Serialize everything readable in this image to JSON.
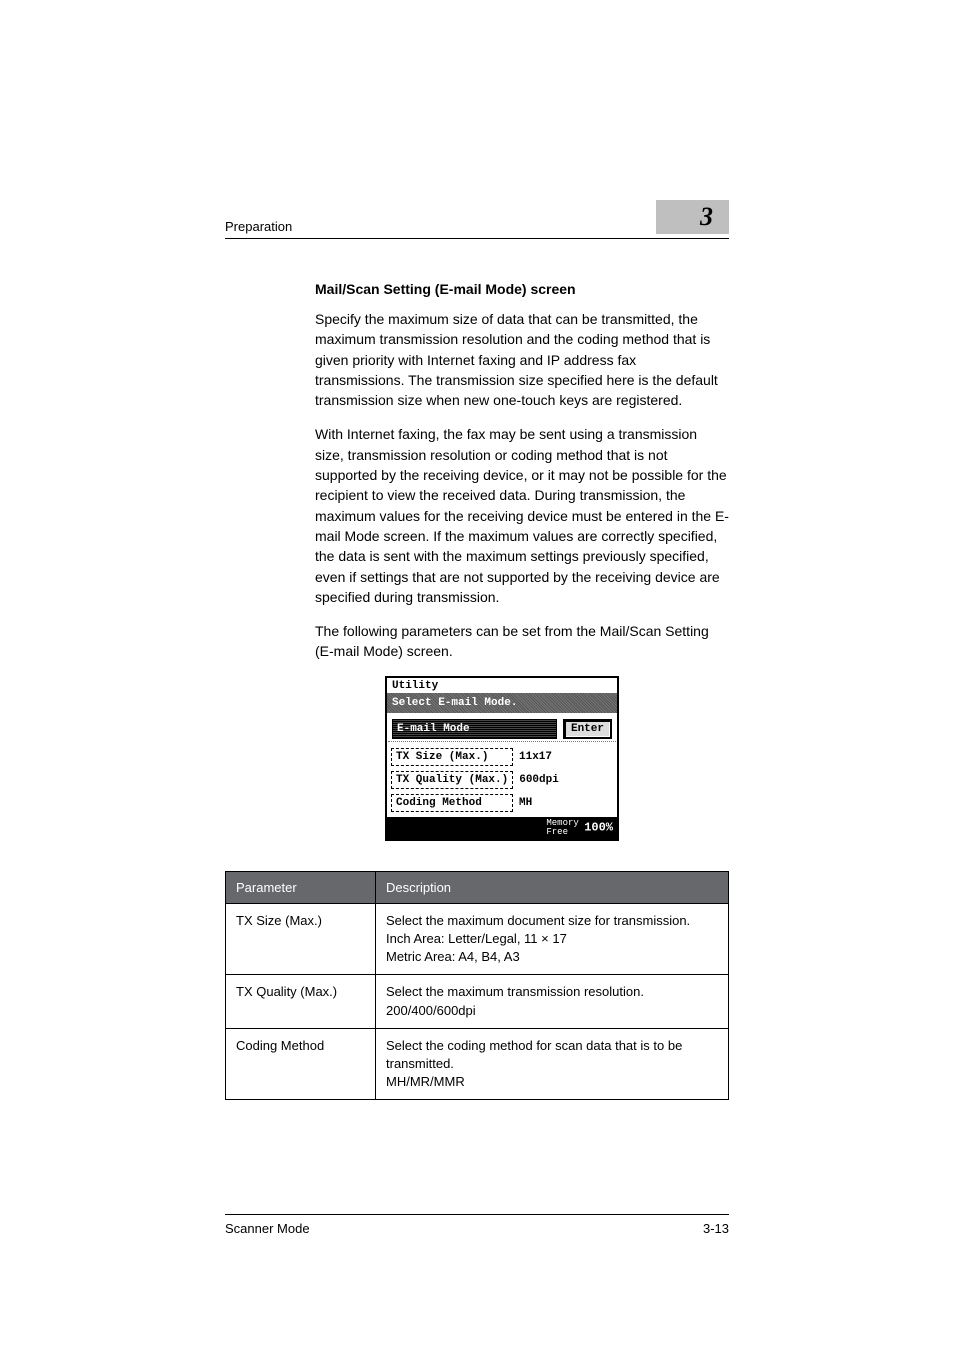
{
  "header": {
    "left": "Preparation",
    "chapter": "3"
  },
  "section_title": "Mail/Scan Setting (E-mail Mode) screen",
  "paragraphs": {
    "p1": "Specify the maximum size of data that can be transmitted, the maximum transmission resolution and the coding method that is given priority with Internet faxing and IP address fax transmissions. The transmission size specified here is the default transmission size when new one-touch keys are registered.",
    "p2": "With Internet faxing, the fax may be sent using a transmission size, transmission resolution or coding method that is not supported by the receiving device, or it may not be possible for the recipient to view the received data. During transmission, the maximum values for the receiving device must be entered in the E-mail Mode screen. If the maximum values are correctly specified, the data is sent with the maximum settings previously specified, even if settings that are not supported by the receiving device are specified during transmission.",
    "p3": "The following parameters can be set from the Mail/Scan Setting (E-mail Mode) screen."
  },
  "lcd": {
    "title": "Utility",
    "banner": "Select E-mail Mode.",
    "mode_label": "E-mail Mode",
    "enter": "Enter",
    "rows": [
      {
        "label": "TX Size (Max.)",
        "value": "11x17"
      },
      {
        "label": "TX Quality (Max.)",
        "value": "600dpi"
      },
      {
        "label": "Coding Method",
        "value": "MH"
      }
    ],
    "footer_label": "Memory\nFree",
    "footer_pct": "100%"
  },
  "table": {
    "headers": {
      "param": "Parameter",
      "desc": "Description"
    },
    "rows": [
      {
        "param": "TX Size (Max.)",
        "desc": "Select the maximum document size for transmission.\nInch Area: Letter/Legal, 11 × 17\nMetric Area: A4, B4, A3"
      },
      {
        "param": "TX Quality (Max.)",
        "desc": "Select the maximum transmission resolution. 200/400/600dpi"
      },
      {
        "param": "Coding Method",
        "desc": "Select the coding method for scan data that is to be transmitted.\nMH/MR/MMR"
      }
    ]
  },
  "footer": {
    "left": "Scanner Mode",
    "right": "3-13"
  }
}
